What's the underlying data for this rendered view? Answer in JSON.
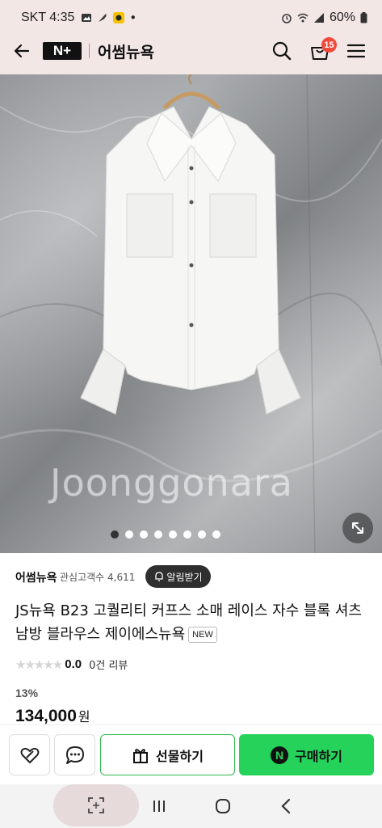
{
  "status_bar": {
    "carrier_time": "SKT 4:35",
    "battery": "60%",
    "dot": "•"
  },
  "header": {
    "logo": "N+",
    "store_name": "어썸뉴욕",
    "cart_count": "15",
    "icons": [
      "back-arrow-icon",
      "search-icon",
      "cart-icon",
      "menu-icon"
    ]
  },
  "gallery": {
    "watermark": "Joonggonara",
    "total_images": 8,
    "active_index": 0
  },
  "seller": {
    "name": "어썸뉴욕",
    "followers_label": "관심고객수 4,611",
    "alarm_button": "알림받기"
  },
  "product": {
    "title": "JS뉴욕 B23 고퀄리티 커프스 소매 레이스 자수 블록 셔츠 남방 블라우스 제이에스뉴욕",
    "badge": "NEW",
    "rating": "0.0",
    "rating_stars": 0,
    "review_count": "0건 리뷰",
    "discount": "13%",
    "price": "134,000",
    "currency": "원"
  },
  "actions": {
    "gift_label": "선물하기",
    "buy_label": "구매하기",
    "npay_symbol": "N"
  },
  "colors": {
    "header_bg": "#f3e7e6",
    "buy_green": "#26d35a",
    "badge_red": "#f04a3a"
  }
}
